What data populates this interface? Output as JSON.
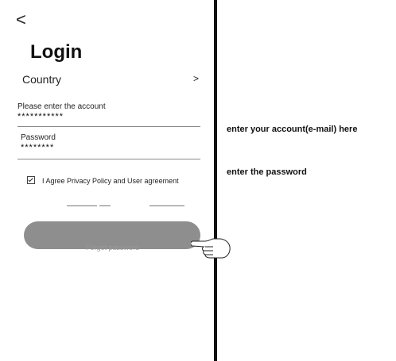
{
  "header": {
    "back_label": "<",
    "title": "Login"
  },
  "country": {
    "label": "Country",
    "chevron": ">"
  },
  "account": {
    "caption": "Please enter the account",
    "value": "***********"
  },
  "password": {
    "caption": "Password",
    "value": "********"
  },
  "agreement": {
    "label": "I Agree Privacy Policy and User agreement",
    "checked": true
  },
  "login_button": {
    "label": ""
  },
  "forgot": {
    "label": "Forget password"
  },
  "annotations": {
    "account_note": "enter your account(e-mail) here",
    "password_note": "enter the password"
  },
  "colors": {
    "button": "#8e8e8e",
    "divider": "#111111"
  }
}
